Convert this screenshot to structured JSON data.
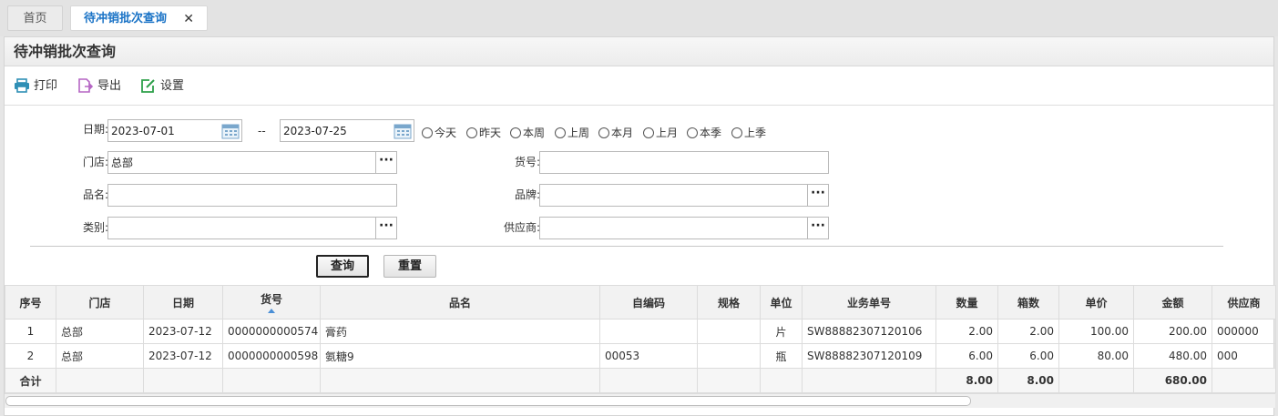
{
  "tabs": {
    "home": "首页",
    "active": "待冲销批次查询"
  },
  "panel": {
    "title": "待冲销批次查询"
  },
  "toolbar": {
    "print": "打印",
    "export": "导出",
    "settings": "设置"
  },
  "form": {
    "date_label": "日期:",
    "date_from": "2023-07-01",
    "date_to": "2023-07-25",
    "date_sep": "--",
    "quick": [
      "今天",
      "昨天",
      "本周",
      "上周",
      "本月",
      "上月",
      "本季",
      "上季"
    ],
    "store_label": "门店:",
    "store_value": "总部",
    "item_no_label": "货号:",
    "item_no_value": "",
    "name_label": "品名:",
    "name_value": "",
    "brand_label": "品牌:",
    "brand_value": "",
    "category_label": "类别:",
    "category_value": "",
    "supplier_label": "供应商:",
    "supplier_value": ""
  },
  "buttons": {
    "query": "查询",
    "reset": "重置"
  },
  "grid": {
    "columns": [
      "序号",
      "门店",
      "日期",
      "货号",
      "品名",
      "自编码",
      "规格",
      "单位",
      "业务单号",
      "数量",
      "箱数",
      "单价",
      "金额",
      "供应商"
    ],
    "rows": [
      [
        "1",
        "总部",
        "2023-07-12",
        "0000000000574",
        "膏药",
        "",
        "",
        "片",
        "SW88882307120106",
        "2.00",
        "2.00",
        "100.00",
        "200.00",
        "000000"
      ],
      [
        "2",
        "总部",
        "2023-07-12",
        "0000000000598",
        "氨糖9",
        "00053",
        "",
        "瓶",
        "SW88882307120109",
        "6.00",
        "6.00",
        "80.00",
        "480.00",
        "000"
      ]
    ],
    "total": [
      "合计",
      "",
      "",
      "",
      "",
      "",
      "",
      "",
      "",
      "8.00",
      "8.00",
      "",
      "680.00",
      ""
    ]
  },
  "colors": {
    "active_tab_text": "#1a73c6",
    "print_icon": "#2f8fb5",
    "export_icon": "#b565c4",
    "settings_icon": "#2ea04a",
    "sort_arrow": "#4a8fd6"
  }
}
